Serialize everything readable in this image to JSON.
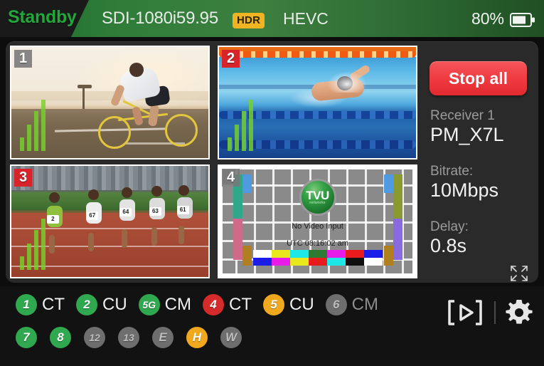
{
  "header": {
    "status": "Standby",
    "source_format": "SDI-1080i59.95",
    "hdr_badge": "HDR",
    "codec": "HEVC",
    "battery_percent": "80%",
    "battery_icon": "battery-icon",
    "status_color": "#21a83a",
    "hdr_color": "#f0b321",
    "bar_color": "#2f7d39"
  },
  "video": {
    "tiles": [
      {
        "number": "1",
        "badge_style": "gray",
        "signal_bars": 4,
        "content": "cyclist-sunrise-road"
      },
      {
        "number": "2",
        "badge_style": "red",
        "signal_bars": 4,
        "content": "swimmer-pool"
      },
      {
        "number": "3",
        "badge_style": "red",
        "signal_bars": 4,
        "content": "runners-track"
      },
      {
        "number": "4",
        "badge_style": "gray",
        "signal_bars": 0,
        "content": "test-pattern"
      }
    ],
    "test_pattern": {
      "logo_title": "TVU",
      "logo_subtitle": "networks",
      "no_signal_text": "No Video Input",
      "timestamp_text": "UTC 08:16:02 am",
      "colorbars_top": [
        "#ffffff",
        "#e8e81c",
        "#1ce8e8",
        "#2c7a33",
        "#e81ce8",
        "#e81c1c",
        "#1c1ce8"
      ],
      "colorbars_bottom": [
        "#1c1ce8",
        "#e81ce8",
        "#e8e81c",
        "#e81c1c",
        "#1ce8e8",
        "#101010",
        "#ffffff"
      ],
      "side_bars": [
        "#4f9ae0",
        "#8a9a2f",
        "#8a6ae0",
        "#b08020",
        "#2fa88a",
        "#d06a8a"
      ]
    },
    "expand_icon": "fullscreen-expand-icon"
  },
  "sidebar": {
    "stop_all_label": "Stop all",
    "stop_all_color": "#ef3a40",
    "receiver_label": "Receiver 1",
    "receiver_value": "PM_X7L",
    "bitrate_label": "Bitrate:",
    "bitrate_value": "10Mbps",
    "delay_label": "Delay:",
    "delay_value": "0.8s"
  },
  "bottom": {
    "channels_row1": [
      {
        "id": "1",
        "name": "CT",
        "color": "green",
        "name_dim": false
      },
      {
        "id": "2",
        "name": "CU",
        "color": "green",
        "name_dim": false
      },
      {
        "id": "5G",
        "name": "CM",
        "color": "green",
        "name_dim": false
      },
      {
        "id": "4",
        "name": "CT",
        "color": "red",
        "name_dim": false
      },
      {
        "id": "5",
        "name": "CU",
        "color": "orange",
        "name_dim": false
      },
      {
        "id": "6",
        "name": "CM",
        "color": "gray",
        "name_dim": true
      }
    ],
    "channels_row2": [
      {
        "id": "7",
        "name": "",
        "color": "green",
        "name_dim": false
      },
      {
        "id": "8",
        "name": "",
        "color": "green",
        "name_dim": false
      },
      {
        "id": "12",
        "name": "",
        "color": "gray",
        "name_dim": true
      },
      {
        "id": "13",
        "name": "",
        "color": "gray",
        "name_dim": true
      },
      {
        "id": "E",
        "name": "",
        "color": "gray",
        "name_dim": true
      },
      {
        "id": "H",
        "name": "",
        "color": "orange",
        "name_dim": false
      },
      {
        "id": "W",
        "name": "",
        "color": "gray",
        "name_dim": true
      }
    ],
    "play_icon": "bracketed-play-icon",
    "settings_icon": "gear-icon"
  }
}
